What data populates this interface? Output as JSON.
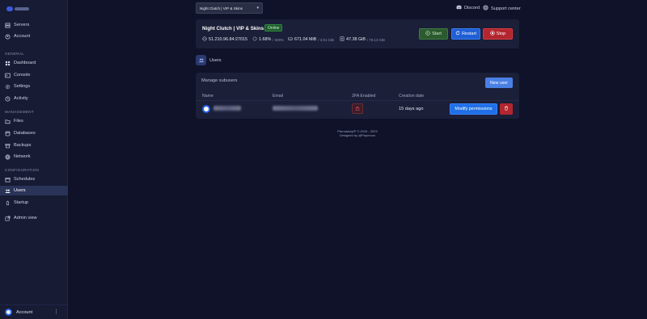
{
  "sidebar": {
    "items": [
      {
        "label": "Servers",
        "icon": "server-icon"
      },
      {
        "label": "Account",
        "icon": "account-icon"
      }
    ],
    "sections": [
      {
        "label": "GENERAL",
        "items": [
          {
            "label": "Dashboard",
            "icon": "dashboard-icon"
          },
          {
            "label": "Console",
            "icon": "console-icon"
          },
          {
            "label": "Settings",
            "icon": "settings-icon"
          },
          {
            "label": "Activity",
            "icon": "activity-icon"
          }
        ]
      },
      {
        "label": "MANAGEMENT",
        "items": [
          {
            "label": "Files",
            "icon": "files-icon"
          },
          {
            "label": "Databases",
            "icon": "database-icon"
          },
          {
            "label": "Backups",
            "icon": "backup-icon"
          },
          {
            "label": "Network",
            "icon": "network-icon"
          }
        ]
      },
      {
        "label": "CONFIGURATION",
        "items": [
          {
            "label": "Schedules",
            "icon": "calendar-icon"
          },
          {
            "label": "Users",
            "icon": "users-icon",
            "active": true
          },
          {
            "label": "Startup",
            "icon": "startup-icon"
          }
        ]
      }
    ],
    "admin_view": "Admin view",
    "account_label": "Account"
  },
  "header": {
    "server_select": "Night Clutch | VIP & Skins",
    "discord": "Discord",
    "support": "Support center"
  },
  "server": {
    "name": "Night Clutch | VIP & Skins",
    "status": "Online",
    "address": "51.210.96.84:27015",
    "cpu": "1.68%",
    "cpu_limit": "/ 300%",
    "memory": "671.04 MiB",
    "memory_limit": "/ 3.91 GiB",
    "disk": "47.38 GiB",
    "disk_limit": "/ 78.13 GiB",
    "buttons": {
      "start": "Start",
      "restart": "Restart",
      "stop": "Stop"
    }
  },
  "users_page": {
    "title": "Users",
    "manage_label": "Manage subusers",
    "new_user": "New user",
    "columns": [
      "Name",
      "Email",
      "2FA Enabled",
      "Creation date"
    ],
    "rows": [
      {
        "created": "15 days ago",
        "modify": "Modify permissions"
      }
    ]
  },
  "footer": {
    "line1": "Pterodactyl® © 2015 - 2023",
    "line2": "Designed by @Paymoon"
  },
  "colors": {
    "background": "#0f1229",
    "sidebar": "#171b33",
    "card": "#1b1f38",
    "accent": "#1f6fe8",
    "danger": "#b3262f",
    "success": "#2b5a2f"
  }
}
